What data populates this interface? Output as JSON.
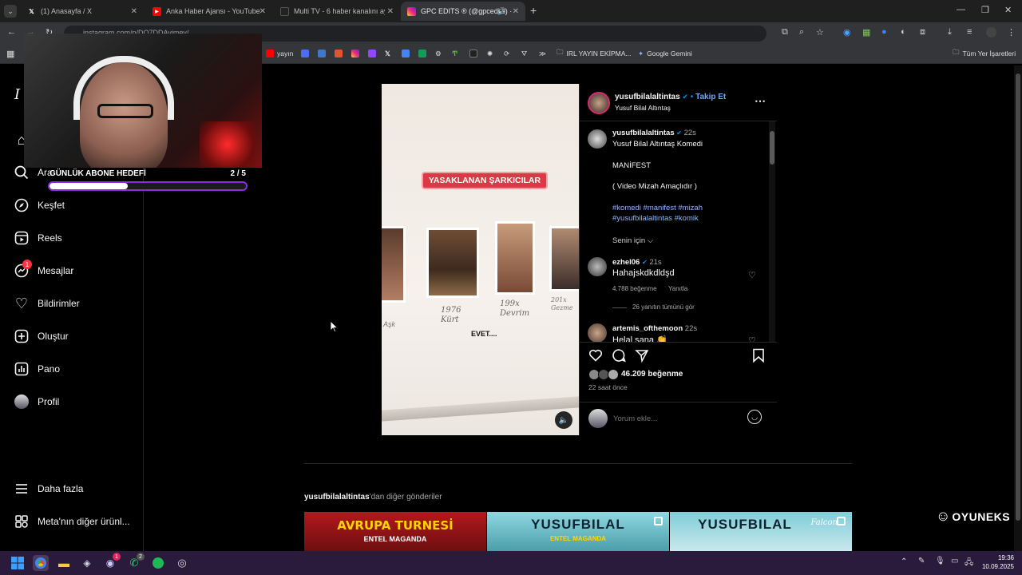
{
  "browser": {
    "tabs": [
      {
        "label": "(1) Anasayfa / X",
        "icon": "x-logo-icon"
      },
      {
        "label": "Anka Haber Ajansı - YouTube",
        "icon": "youtube-icon"
      },
      {
        "label": "Multi TV - 6 haber kanalını ayn",
        "icon": "tv-icon"
      },
      {
        "label": "GPC EDITS ® (@gpcedits) ·",
        "icon": "instagram-icon",
        "active": true
      }
    ],
    "url": "instagram.com/p/DO7DDAvimey/",
    "bookmarks": {
      "yayin_label": "yayın",
      "folder_label": "IRL YAYIN EKİPMA...",
      "gemini_label": "Google Gemini",
      "all_bookmarks_label": "Tüm Yer İşaretleri"
    }
  },
  "overlay": {
    "goal_label": "GÜNLÜK ABONE HEDEFİ",
    "goal_count": "2 / 5",
    "goal_progress": 0.4
  },
  "sidebar": {
    "search_label": "Ara",
    "items": [
      {
        "label": "Keşfet",
        "icon": "compass-icon"
      },
      {
        "label": "Reels",
        "icon": "reels-icon"
      },
      {
        "label": "Mesajlar",
        "icon": "messenger-icon",
        "badge": "1"
      },
      {
        "label": "Bildirimler",
        "icon": "heart-icon"
      },
      {
        "label": "Oluştur",
        "icon": "plus-square-icon"
      },
      {
        "label": "Pano",
        "icon": "dashboard-icon"
      },
      {
        "label": "Profil",
        "icon": "avatar"
      }
    ],
    "more_label": "Daha fazla",
    "meta_label": "Meta'nın diğer ürünl..."
  },
  "post": {
    "media": {
      "banner": "YASAKLANAN ŞARKICILAR",
      "caption_overlay": "EVET....",
      "board_texts": [
        "1976 Kürt",
        "199x Devrim",
        "201x Gezme",
        "Aşk"
      ]
    },
    "header": {
      "username": "yusufbilalaltintas",
      "follow_label": "Takip Et",
      "separator": "•",
      "subtitle": "Yusuf Bilal Altıntaş"
    },
    "caption": {
      "username": "yusufbilalaltintas",
      "time": "22s",
      "lines": [
        "Yusuf Bilal Altıntaş Komedi",
        "MANİFEST",
        "( Video Mizah Amaçlıdır )"
      ],
      "hashtags_line1": "#komedi #manifest #mizah",
      "hashtags_line2": "#yusufbilalaltintas #komik"
    },
    "for_you_label": "Senin için",
    "comments": [
      {
        "username": "ezhel06",
        "time": "21s",
        "text": "Hahajskdkdldşd",
        "likes": "4.788 beğenme",
        "reply_label": "Yanıtla",
        "view_replies": "26 yanıtın tümünü gör"
      },
      {
        "username": "artemis_ofthemoon",
        "time": "22s",
        "text": "Helal sana 👏"
      }
    ],
    "likes": "46.209 beğenme",
    "posted": "22 saat önce",
    "comment_placeholder": "Yorum ekle..."
  },
  "more_posts": {
    "author": "yusufbilalaltintas",
    "suffix": "'dan diğer gönderiler",
    "thumbs": [
      {
        "title": "AVRUPA TURNESİ",
        "sub": "ENTEL MAGANDA"
      },
      {
        "title": "YUSUFBILAL",
        "sub": "ENTEL MAGANDA"
      },
      {
        "title": "YUSUFBILAL",
        "sub": "Falcon"
      }
    ]
  },
  "watermark": "OYUNEKS",
  "taskbar": {
    "time": "19:36",
    "date": "10.09.2025",
    "discord_badge": "1",
    "whatsapp_badge": "2"
  },
  "colors": {
    "instagram_blue": "#0095f6",
    "goal_bar_border": "#8a2be2",
    "banner_red": "#d93a45"
  }
}
